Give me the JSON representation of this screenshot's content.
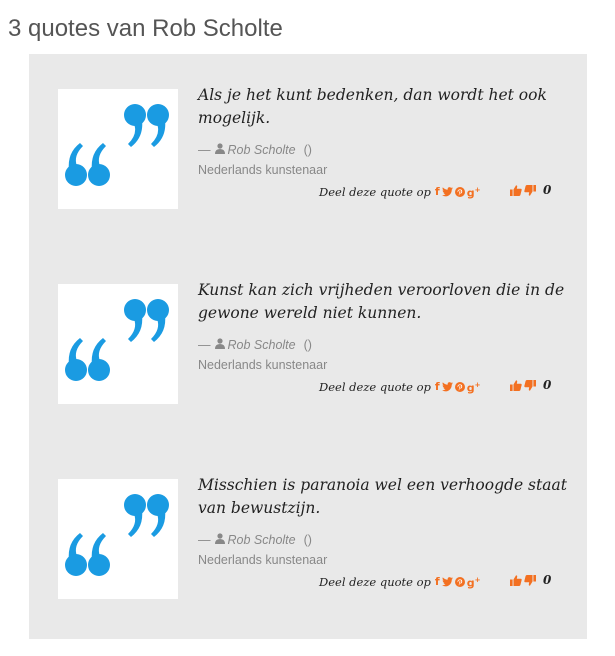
{
  "page": {
    "title": "3 quotes van Rob Scholte"
  },
  "quotes": [
    {
      "text": "Als je het kunt bedenken, dan wordt het ook mogelijk.",
      "dash": "—",
      "author": "Rob Scholte",
      "parens": "()",
      "description": "Nederlands kunstenaar",
      "share_label": "Deel deze quote op",
      "votes": "0"
    },
    {
      "text": "Kunst kan zich vrijheden veroorloven die in de gewone wereld niet kunnen.",
      "dash": "—",
      "author": "Rob Scholte",
      "parens": "()",
      "description": "Nederlands kunstenaar",
      "share_label": "Deel deze quote op",
      "votes": "0"
    },
    {
      "text": "Misschien is paranoia wel een verhoogde staat van bewustzijn.",
      "dash": "—",
      "author": "Rob Scholte",
      "parens": "()",
      "description": "Nederlands kunstenaar",
      "share_label": "Deel deze quote op",
      "votes": "0"
    }
  ],
  "icons": {
    "quote_mark": "quote-marks-icon",
    "user": "user-icon",
    "facebook": "facebook-icon",
    "twitter": "twitter-icon",
    "pinterest": "pinterest-icon",
    "googleplus": "google-plus-icon",
    "thumbs_up": "thumbs-up-icon",
    "thumbs_down": "thumbs-down-icon"
  },
  "colors": {
    "quote_blue": "#1a9be2",
    "social_orange": "#f37021",
    "panel_bg": "#e9e9e9"
  }
}
